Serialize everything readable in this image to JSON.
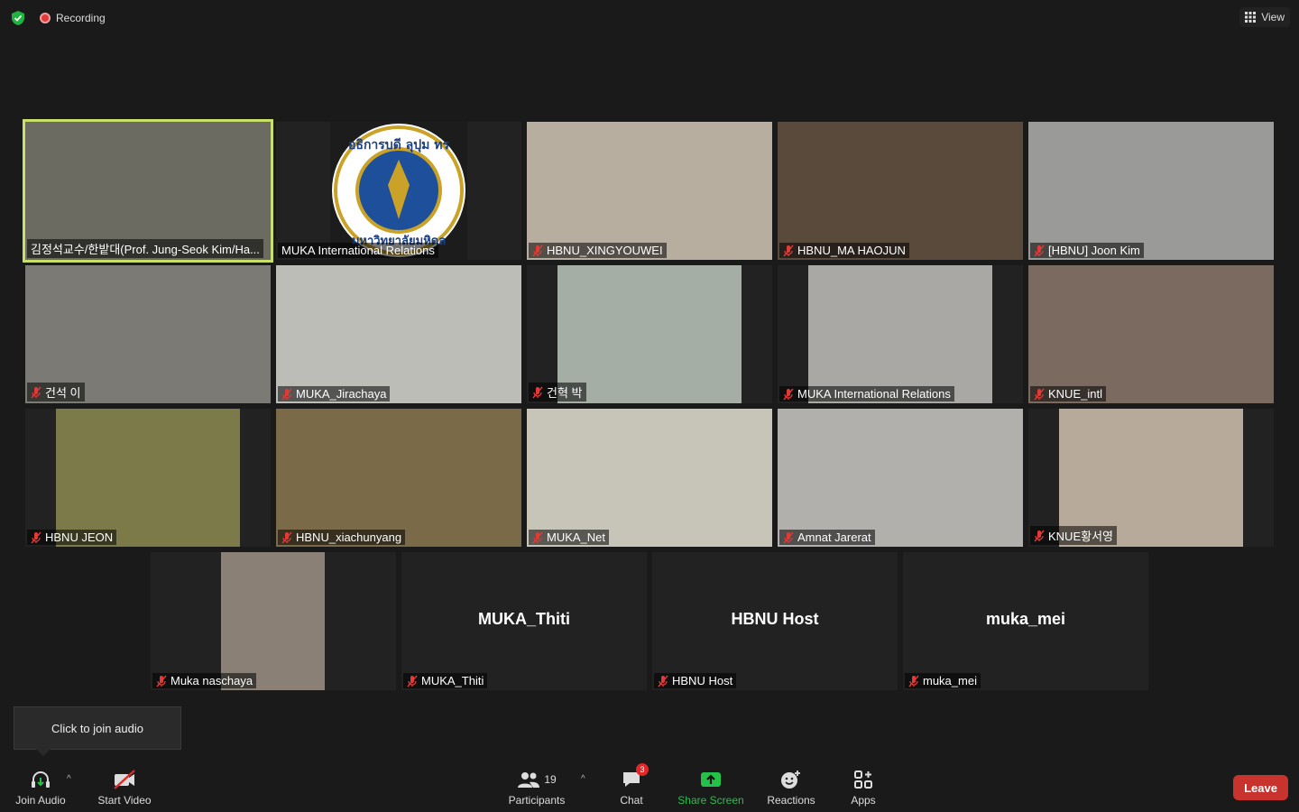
{
  "header": {
    "recording_label": "Recording",
    "view_label": "View"
  },
  "participants": [
    {
      "name": "김정석교수/한밭대(Prof. Jung-Seok Kim/Ha...",
      "muted": false,
      "bg": "#6b6b62"
    },
    {
      "name": "MUKA International Relations",
      "muted": false,
      "bg": "#1c1c1c",
      "logo": true,
      "logo_text_top": "อธิการบดี ลุปุม ทร",
      "logo_text_bottom": "มหาวิทยาลัยมหิดล"
    },
    {
      "name": "HBNU_XINGYOUWEI",
      "muted": true,
      "bg": "#b8aea0"
    },
    {
      "name": "HBNU_MA HAOJUN",
      "muted": true,
      "bg": "#5a4a3c"
    },
    {
      "name": "[HBNU] Joon Kim",
      "muted": true,
      "bg": "#9a9a98"
    },
    {
      "name": "건석 이",
      "muted": true,
      "bg": "#7b7a74"
    },
    {
      "name": "MUKA_Jirachaya",
      "muted": true,
      "bg": "#bdbdb8"
    },
    {
      "name": "건혁 박",
      "muted": true,
      "bg": "#a5aea5"
    },
    {
      "name": "MUKA International Relations",
      "muted": true,
      "bg": "#a9a8a4"
    },
    {
      "name": "KNUE_intl",
      "muted": true,
      "bg": "#7a6a60"
    },
    {
      "name": "HBNU JEON",
      "muted": true,
      "bg": "#7d7a4a"
    },
    {
      "name": "HBNU_xiachunyang",
      "muted": true,
      "bg": "#7a6a48"
    },
    {
      "name": "MUKA_Net",
      "muted": true,
      "bg": "#c7c4b8"
    },
    {
      "name": "Amnat Jarerat",
      "muted": true,
      "bg": "#b2b0ac"
    },
    {
      "name": "KNUE황서영",
      "muted": true,
      "bg": "#b8aa9a"
    },
    {
      "name": "Muka naschaya",
      "muted": true,
      "bg": "#8a8076"
    },
    {
      "name": "MUKA_Thiti",
      "muted": true,
      "no_video": true,
      "display_name": "MUKA_Thiti"
    },
    {
      "name": "HBNU Host",
      "muted": true,
      "no_video": true,
      "display_name": "HBNU Host"
    },
    {
      "name": "muka_mei",
      "muted": true,
      "no_video": true,
      "display_name": "muka_mei"
    }
  ],
  "tooltip": {
    "text": "Click to join audio"
  },
  "toolbar": {
    "join_audio": "Join Audio",
    "start_video": "Start Video",
    "participants": "Participants",
    "participants_count": "19",
    "chat": "Chat",
    "chat_badge": "3",
    "share_screen": "Share Screen",
    "reactions": "Reactions",
    "apps": "Apps",
    "leave": "Leave"
  },
  "colors": {
    "share_green": "#25c24a",
    "leave_red": "#c8332d",
    "active_speaker": "#c8e06a"
  }
}
